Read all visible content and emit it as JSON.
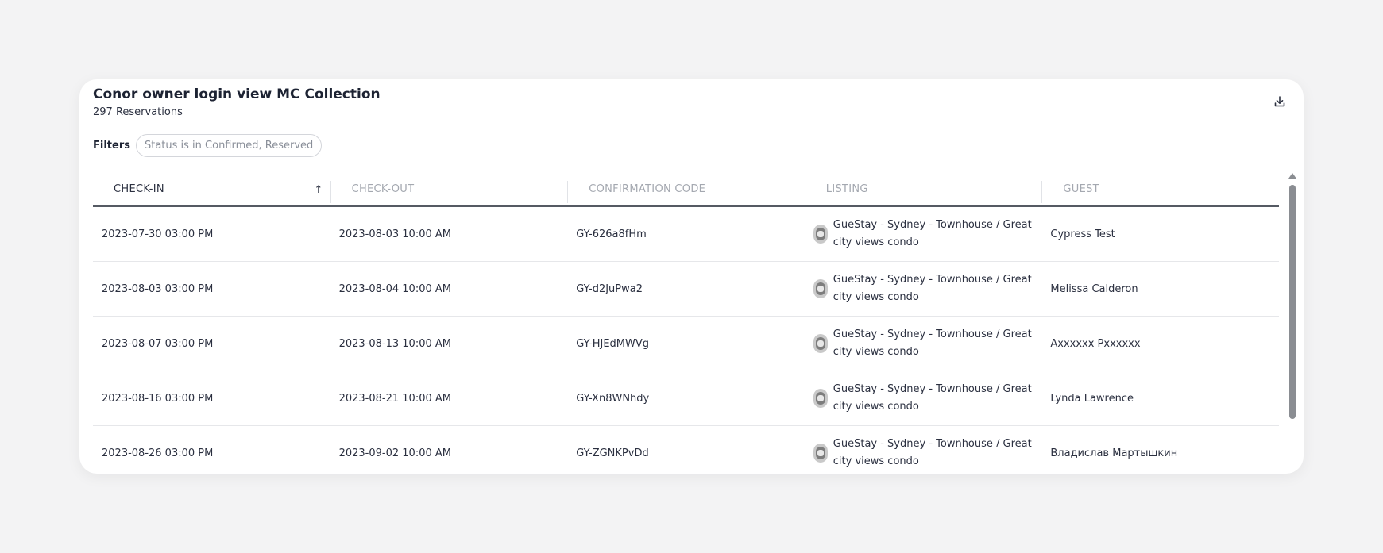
{
  "header": {
    "title": "Conor owner login view MC Collection",
    "subtitle": "297 Reservations"
  },
  "filters": {
    "label": "Filters",
    "chip": "Status is in Confirmed, Reserved"
  },
  "table": {
    "columns": [
      "CHECK-IN",
      "CHECK-OUT",
      "CONFIRMATION CODE",
      "LISTING",
      "GUEST"
    ],
    "sort_arrow": "↑",
    "rows": [
      {
        "checkin": "2023-07-30 03:00 PM",
        "checkout": "2023-08-03 10:00 AM",
        "code": "GY-626a8fHm",
        "listing": "GueStay - Sydney - Townhouse / Great city views condo",
        "guest": "Cypress Test"
      },
      {
        "checkin": "2023-08-03 03:00 PM",
        "checkout": "2023-08-04 10:00 AM",
        "code": "GY-d2JuPwa2",
        "listing": "GueStay - Sydney - Townhouse / Great city views condo",
        "guest": "Melissa Calderon"
      },
      {
        "checkin": "2023-08-07 03:00 PM",
        "checkout": "2023-08-13 10:00 AM",
        "code": "GY-HJEdMWVg",
        "listing": "GueStay - Sydney - Townhouse / Great city views condo",
        "guest": "Axxxxxx Pxxxxxx"
      },
      {
        "checkin": "2023-08-16 03:00 PM",
        "checkout": "2023-08-21 10:00 AM",
        "code": "GY-Xn8WNhdy",
        "listing": "GueStay - Sydney - Townhouse / Great city views condo",
        "guest": "Lynda Lawrence"
      },
      {
        "checkin": "2023-08-26 03:00 PM",
        "checkout": "2023-09-02 10:00 AM",
        "code": "GY-ZGNKPvDd",
        "listing": "GueStay - Sydney - Townhouse / Great city views condo",
        "guest": "Владислав Мартышкин"
      }
    ]
  },
  "icons": {
    "download": "download-icon",
    "listing_thumb": "listing-thumbnail-icon"
  }
}
